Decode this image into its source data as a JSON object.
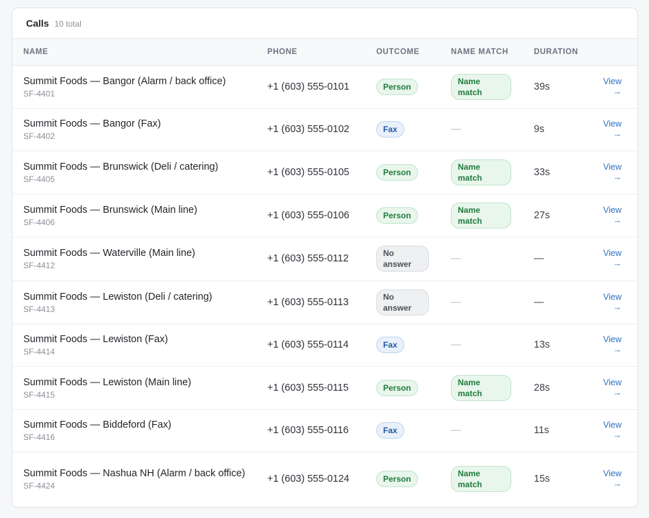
{
  "header": {
    "title": "Calls",
    "count": "10 total"
  },
  "columns": {
    "name": "NAME",
    "phone": "PHONE",
    "outcome": "OUTCOME",
    "match": "NAME MATCH",
    "duration": "DURATION"
  },
  "view_label": "View",
  "view_arrow": "→",
  "dash": "—",
  "rows": [
    {
      "name": "Summit Foods — Bangor (Alarm / back office)",
      "id": "SF-4401",
      "phone": "+1 (603) 555-0101",
      "outcome": "Person",
      "outcome_type": "person",
      "match": "Name match",
      "duration": "39s"
    },
    {
      "name": "Summit Foods — Bangor (Fax)",
      "id": "SF-4402",
      "phone": "+1 (603) 555-0102",
      "outcome": "Fax",
      "outcome_type": "fax",
      "match": "",
      "duration": "9s"
    },
    {
      "name": "Summit Foods — Brunswick (Deli / catering)",
      "id": "SF-4405",
      "phone": "+1 (603) 555-0105",
      "outcome": "Person",
      "outcome_type": "person",
      "match": "Name match",
      "duration": "33s"
    },
    {
      "name": "Summit Foods — Brunswick (Main line)",
      "id": "SF-4406",
      "phone": "+1 (603) 555-0106",
      "outcome": "Person",
      "outcome_type": "person",
      "match": "Name match",
      "duration": "27s"
    },
    {
      "name": "Summit Foods — Waterville (Main line)",
      "id": "SF-4412",
      "phone": "+1 (603) 555-0112",
      "outcome": "No answer",
      "outcome_type": "noanswer",
      "match": "",
      "duration": "—"
    },
    {
      "name": "Summit Foods — Lewiston (Deli / catering)",
      "id": "SF-4413",
      "phone": "+1 (603) 555-0113",
      "outcome": "No answer",
      "outcome_type": "noanswer",
      "match": "",
      "duration": "—"
    },
    {
      "name": "Summit Foods — Lewiston (Fax)",
      "id": "SF-4414",
      "phone": "+1 (603) 555-0114",
      "outcome": "Fax",
      "outcome_type": "fax",
      "match": "",
      "duration": "13s"
    },
    {
      "name": "Summit Foods — Lewiston (Main line)",
      "id": "SF-4415",
      "phone": "+1 (603) 555-0115",
      "outcome": "Person",
      "outcome_type": "person",
      "match": "Name match",
      "duration": "28s"
    },
    {
      "name": "Summit Foods — Biddeford (Fax)",
      "id": "SF-4416",
      "phone": "+1 (603) 555-0116",
      "outcome": "Fax",
      "outcome_type": "fax",
      "match": "",
      "duration": "11s"
    },
    {
      "name": "Summit Foods — Nashua NH (Alarm / back office)",
      "id": "SF-4424",
      "phone": "+1 (603) 555-0124",
      "outcome": "Person",
      "outcome_type": "person",
      "match": "Name match",
      "duration": "15s"
    }
  ]
}
